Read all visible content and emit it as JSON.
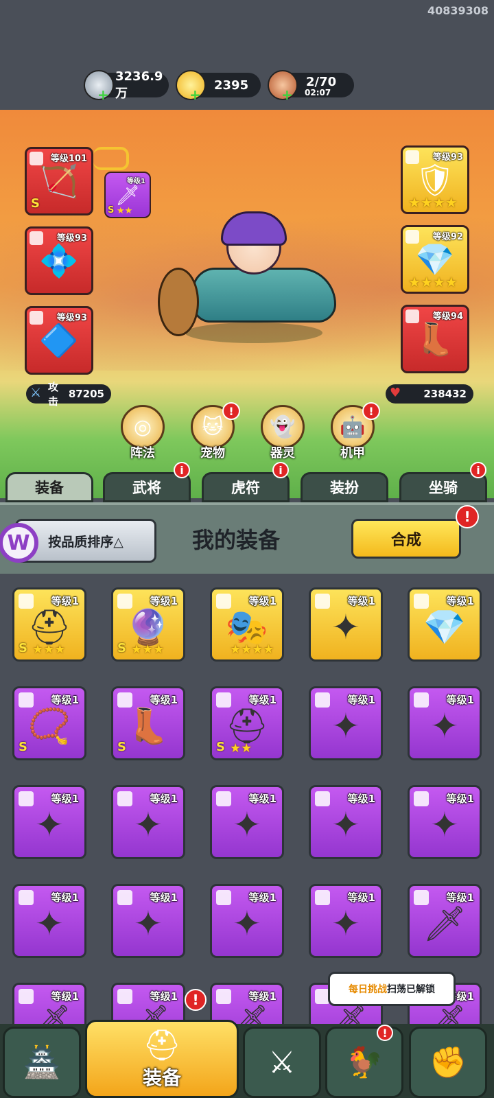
{
  "user_id": "40839308",
  "resources": {
    "silver": {
      "value": "3236.9万",
      "icon": "silver-coin-icon"
    },
    "gold": {
      "value": "2395",
      "icon": "gold-ingot-icon"
    },
    "stamina": {
      "value": "2/70",
      "timer": "02:07",
      "icon": "meat-icon"
    }
  },
  "character": {
    "left_slots": [
      {
        "level": "等级101",
        "rank": "S",
        "color": "red",
        "icon": "crossbow-weapon-icon"
      },
      {
        "level": "等级93",
        "color": "red",
        "icon": "amulet-icon"
      },
      {
        "level": "等级93",
        "color": "red",
        "icon": "crystal-icon"
      }
    ],
    "linked_slot": {
      "level": "等级1",
      "rank": "S",
      "stars": "★★",
      "icon": "sword-icon"
    },
    "right_slots": [
      {
        "level": "等级93",
        "stars": "★★★★",
        "color": "gold",
        "icon": "armor-icon"
      },
      {
        "level": "等级92",
        "stars": "★★★★",
        "color": "gold",
        "icon": "bracer-icon"
      },
      {
        "level": "等级94",
        "color": "red",
        "icon": "boots-icon"
      }
    ],
    "attack_label": "攻击",
    "attack_value": "87205",
    "hp_value": "238432"
  },
  "features": [
    {
      "label": "阵法",
      "icon": "formation-icon",
      "badge": false
    },
    {
      "label": "宠物",
      "icon": "pet-cat-icon",
      "badge": true
    },
    {
      "label": "器灵",
      "icon": "spirit-icon",
      "badge": false
    },
    {
      "label": "机甲",
      "icon": "mecha-icon",
      "badge": true
    }
  ],
  "tabs": [
    {
      "label": "装备",
      "active": true,
      "badge": false
    },
    {
      "label": "武将",
      "active": false,
      "badge": true
    },
    {
      "label": "虎符",
      "active": false,
      "badge": true
    },
    {
      "label": "装扮",
      "active": false,
      "badge": false
    },
    {
      "label": "坐骑",
      "active": false,
      "badge": true
    }
  ],
  "badge_symbol": "i",
  "alert_symbol": "!",
  "header": {
    "sort_label": "按品质排序△",
    "title": "我的装备",
    "synth_label": "合成"
  },
  "logo_letter": "W",
  "inventory": [
    {
      "level": "等级1",
      "color": "gold",
      "icon": "helmet-icon",
      "rank": "S",
      "stars": "★★★"
    },
    {
      "level": "等级1",
      "color": "gold",
      "icon": "orb-icon",
      "rank": "S",
      "stars": "★★★"
    },
    {
      "level": "等级1",
      "color": "gold",
      "icon": "mask-icon",
      "rank": "",
      "stars": "★★★★"
    },
    {
      "level": "等级1",
      "color": "gold",
      "icon": "shuriken-icon",
      "rank": "",
      "stars": ""
    },
    {
      "level": "等级1",
      "color": "gold",
      "icon": "bracer-icon",
      "rank": "",
      "stars": ""
    },
    {
      "level": "等级1",
      "color": "purple",
      "icon": "necklace-icon",
      "rank": "S",
      "stars": ""
    },
    {
      "level": "等级1",
      "color": "purple",
      "icon": "boots-icon",
      "rank": "S",
      "stars": ""
    },
    {
      "level": "等级1",
      "color": "purple",
      "icon": "helmet-icon",
      "rank": "S",
      "stars": "★★"
    },
    {
      "level": "等级1",
      "color": "purple",
      "icon": "shuriken-icon",
      "rank": "",
      "stars": ""
    },
    {
      "level": "等级1",
      "color": "purple",
      "icon": "shuriken-icon",
      "rank": "",
      "stars": ""
    },
    {
      "level": "等级1",
      "color": "purple",
      "icon": "shuriken-icon",
      "rank": "",
      "stars": ""
    },
    {
      "level": "等级1",
      "color": "purple",
      "icon": "shuriken-icon",
      "rank": "",
      "stars": ""
    },
    {
      "level": "等级1",
      "color": "purple",
      "icon": "shuriken-icon",
      "rank": "",
      "stars": ""
    },
    {
      "level": "等级1",
      "color": "purple",
      "icon": "shuriken-icon",
      "rank": "",
      "stars": ""
    },
    {
      "level": "等级1",
      "color": "purple",
      "icon": "shuriken-icon",
      "rank": "",
      "stars": ""
    },
    {
      "level": "等级1",
      "color": "purple",
      "icon": "shuriken-icon",
      "rank": "",
      "stars": ""
    },
    {
      "level": "等级1",
      "color": "purple",
      "icon": "shuriken-icon",
      "rank": "",
      "stars": ""
    },
    {
      "level": "等级1",
      "color": "purple",
      "icon": "shuriken-icon",
      "rank": "",
      "stars": ""
    },
    {
      "level": "等级1",
      "color": "purple",
      "icon": "shuriken-icon",
      "rank": "",
      "stars": ""
    },
    {
      "level": "等级1",
      "color": "purple",
      "icon": "scimitar-icon",
      "rank": "",
      "stars": ""
    },
    {
      "level": "等级1",
      "color": "purple",
      "icon": "sword-icon",
      "rank": "",
      "stars": ""
    },
    {
      "level": "等级1",
      "color": "purple",
      "icon": "sword-icon",
      "rank": "",
      "stars": ""
    },
    {
      "level": "等级1",
      "color": "purple",
      "icon": "sword-icon",
      "rank": "",
      "stars": ""
    },
    {
      "level": "等级1",
      "color": "purple",
      "icon": "sword-icon",
      "rank": "",
      "stars": ""
    },
    {
      "level": "等级1",
      "color": "purple",
      "icon": "sword-icon",
      "rank": "",
      "stars": ""
    }
  ],
  "tooltip": {
    "highlight": "每日挑战",
    "text": "扫荡已解锁"
  },
  "bottom_nav": [
    {
      "label": "",
      "icon": "palace-icon",
      "active": false,
      "badge": false
    },
    {
      "label": "装备",
      "icon": "knight-helmet-icon",
      "active": true,
      "badge": true
    },
    {
      "label": "",
      "icon": "crossed-swords-icon",
      "active": false,
      "badge": false
    },
    {
      "label": "",
      "icon": "rooster-icon",
      "active": false,
      "badge": true
    },
    {
      "label": "",
      "icon": "fist-icon",
      "active": false,
      "badge": false
    }
  ],
  "colors": {
    "gold": "#f5c431",
    "purple": "#b048e6",
    "red": "#e23b3b",
    "panel": "#4a4f58"
  }
}
